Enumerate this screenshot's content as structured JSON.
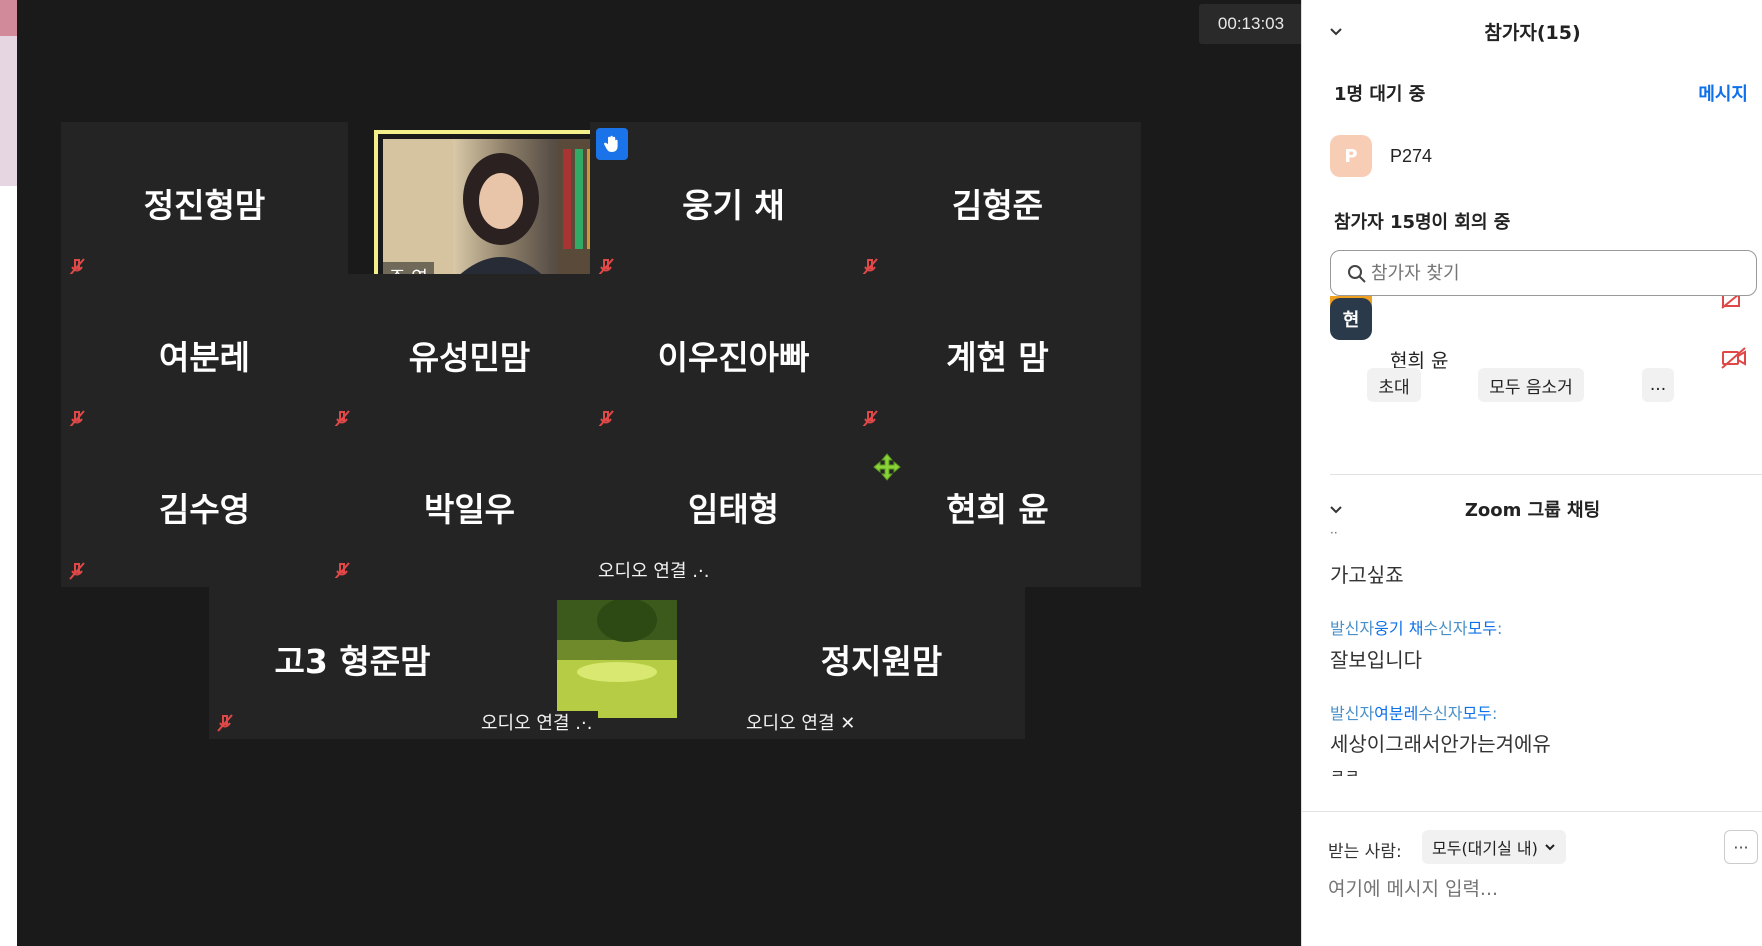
{
  "meeting": {
    "timer": "00:13:03",
    "tiles": [
      {
        "name": "정진형맘",
        "muted": true
      },
      {
        "name": "웅기 채",
        "muted": true,
        "hand_raised": true
      },
      {
        "name": "김형준",
        "muted": true
      },
      {
        "name": "여분레",
        "muted": true
      },
      {
        "name": "유성민맘",
        "muted": true
      },
      {
        "name": "이우진아빠",
        "muted": true
      },
      {
        "name": "계현 맘",
        "muted": true
      },
      {
        "name": "김수영",
        "muted": true
      },
      {
        "name": "박일우",
        "muted": true
      },
      {
        "name": "임태형",
        "audio": "오디오 연결"
      },
      {
        "name": "현희 윤"
      },
      {
        "name": "고3 형준맘",
        "muted": true
      },
      {
        "name": "",
        "audio": "오디오 연결"
      },
      {
        "name": "정지원맘",
        "audio": "오디오 연결"
      }
    ],
    "active_speaker": {
      "name": "주 연"
    }
  },
  "panel": {
    "participants_title": "참가자(15)",
    "waiting_label": "1명 대기 중",
    "message_link": "메시지",
    "waiting_user": {
      "initial": "P",
      "name": "P274",
      "color": "#f7cdb5"
    },
    "in_meeting_label": "참가자 15명이 회의 중",
    "search_placeholder": "참가자 찾기",
    "members": [
      {
        "initial": "현",
        "name": "현희 윤",
        "color": "#2b3a4a"
      }
    ],
    "buttons": {
      "invite": "초대",
      "mute_all": "모두 음소거",
      "more": "..."
    },
    "chat_title": "Zoom 그룹 채팅",
    "chat": {
      "msg0": "가고싶죠",
      "msg1_prefix": "발신자",
      "msg1_sender": "웅기 채",
      "msg1_mid": "수신자",
      "msg1_to": "모두",
      "msg1_text": "잘보입니다",
      "msg2_prefix": "발신자",
      "msg2_sender": "여분레",
      "msg2_mid": "수신자",
      "msg2_to": "모두",
      "msg2_text": "세상이그래서안가는겨에유",
      "msg3_partial": "ㅋㅋ"
    },
    "recipient_label": "받는 사람:",
    "recipient_value": "모두(대기실 내)",
    "more_options": "···",
    "message_placeholder": "여기에 메시지 입력..."
  }
}
